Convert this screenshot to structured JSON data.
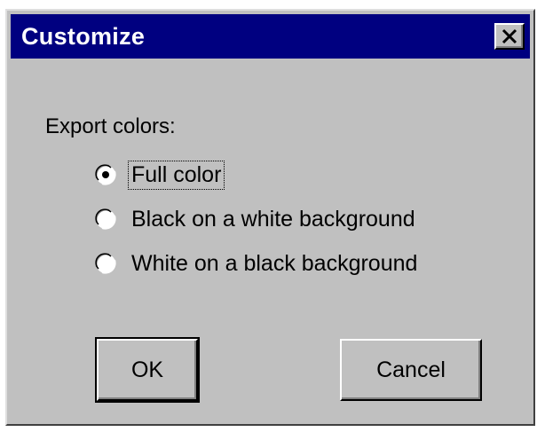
{
  "window": {
    "title": "Customize",
    "close_glyph": "close-icon",
    "title_bar_color": "#000080",
    "body_color": "#c0c0c0"
  },
  "export_colors": {
    "label": "Export colors:",
    "options": [
      {
        "label": "Full color",
        "selected": true,
        "focused": true
      },
      {
        "label": "Black on a white background",
        "selected": false,
        "focused": false
      },
      {
        "label": "White on a black background",
        "selected": false,
        "focused": false
      }
    ]
  },
  "buttons": {
    "ok_label": "OK",
    "cancel_label": "Cancel"
  }
}
